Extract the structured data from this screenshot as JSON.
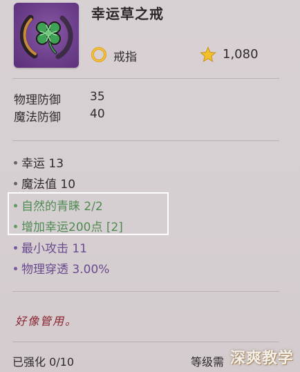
{
  "item": {
    "name": "幸运草之戒",
    "type": "戒指",
    "price": "1,080"
  },
  "stats": [
    {
      "label": "物理防御",
      "value": "35"
    },
    {
      "label": "魔法防御",
      "value": "40"
    }
  ],
  "attributes": [
    {
      "text": "幸运 13",
      "style": "normal"
    },
    {
      "text": "魔法值 10",
      "style": "normal"
    },
    {
      "text": "自然的青睐 2/2",
      "style": "green"
    },
    {
      "text": "增加幸运200点 [2]",
      "style": "green"
    },
    {
      "text": "最小攻击 11",
      "style": "purple"
    },
    {
      "text": "物理穿透 3.00%",
      "style": "purple"
    }
  ],
  "flavor_text": "好像管用。",
  "footer": {
    "enhance": "已强化 0/10",
    "level": "等级需"
  },
  "watermark": "深爽教学",
  "colors": {
    "icon_bg": "#6c3f8c",
    "set_bonus_green": "#4f8a52",
    "stat_purple": "#6a4a8e",
    "flavor_red": "#8a2430"
  },
  "icons": {
    "item": "clover-ring-icon",
    "type": "ring-icon",
    "price": "star-icon"
  }
}
